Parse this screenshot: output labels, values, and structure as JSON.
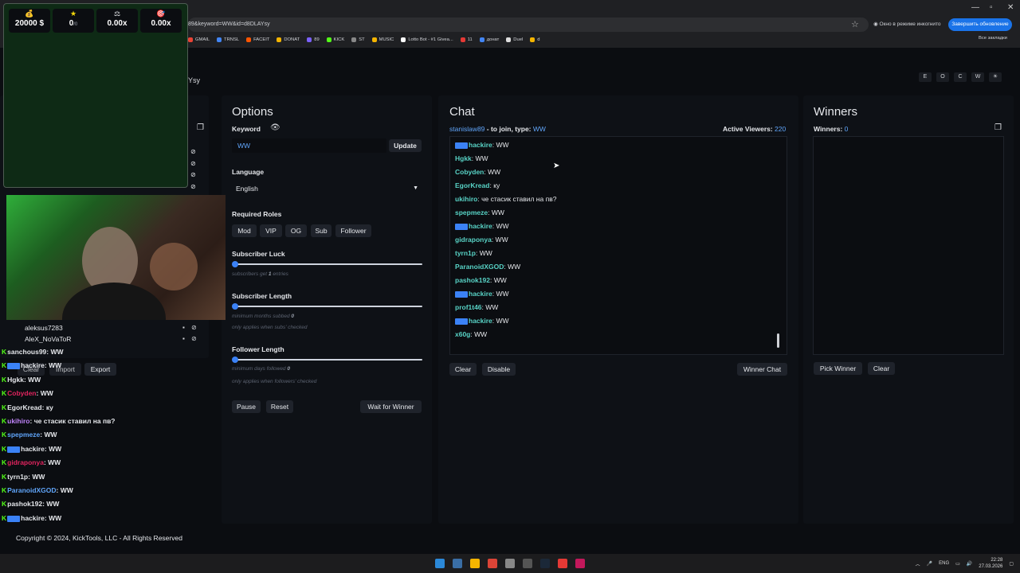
{
  "browser": {
    "url": "89&keyword=WW&id=d8DLAYsy",
    "incognito_label": "Окно в режиме инкогнито",
    "update_button": "Завершить обновление",
    "all_bookmarks": "Все закладки",
    "bookmarks": [
      {
        "label": "GMAIL",
        "color": "#ea4335"
      },
      {
        "label": "TRNSL",
        "color": "#4285f4"
      },
      {
        "label": "FACEIT",
        "color": "#ff5500"
      },
      {
        "label": "DONAT",
        "color": "#f4b400"
      },
      {
        "label": "89",
        "color": "#7b61ff"
      },
      {
        "label": "KICK",
        "color": "#53fc18"
      },
      {
        "label": "ST",
        "color": "#888888"
      },
      {
        "label": "MUSIC",
        "color": "#f4b400"
      },
      {
        "label": "Lotto Bot - #1 Givea...",
        "color": "#ffffff"
      },
      {
        "label": "11",
        "color": "#e53935"
      },
      {
        "label": "донат",
        "color": "#4285f4"
      },
      {
        "label": "Duel",
        "color": "#dddddd"
      },
      {
        "label": "d",
        "color": "#f4b400"
      }
    ]
  },
  "page": {
    "title_fragment": "Ysy",
    "top_buttons": [
      "E",
      "O",
      "C",
      "W",
      "☀"
    ]
  },
  "overlay": {
    "stats": [
      {
        "icon": "money-bag-icon",
        "glyph": "💰",
        "value": "20000 $"
      },
      {
        "icon": "star-icon",
        "glyph": "★",
        "value": "0",
        "suffix": "/0"
      },
      {
        "icon": "scale-icon",
        "glyph": "⚖",
        "value": "0.00x"
      },
      {
        "icon": "target-icon",
        "glyph": "🎯",
        "value": "0.00x"
      }
    ]
  },
  "options": {
    "title": "Options",
    "keyword_label": "Keyword",
    "keyword_value": "WW",
    "update_button": "Update",
    "language_label": "Language",
    "language_value": "English",
    "roles_label": "Required Roles",
    "roles": [
      "Mod",
      "VIP",
      "OG",
      "Sub",
      "Follower"
    ],
    "sub_luck_label": "Subscriber Luck",
    "sub_luck_hint_a": "subscribers get ",
    "sub_luck_value": "1",
    "sub_luck_hint_b": " entries",
    "sub_length_label": "Subscriber Length",
    "sub_length_hint": "minimum months subbed ",
    "sub_length_value": "0",
    "sub_length_note": "only applies when subs' checked",
    "follower_length_label": "Follower Length",
    "follower_length_hint": "minimum days followed ",
    "follower_length_value": "0",
    "follower_length_note": "only applies when followers' checked",
    "pause_button": "Pause",
    "reset_button": "Reset",
    "wait_button": "Wait for Winner"
  },
  "chat": {
    "title": "Chat",
    "join_user": "stanislaw89",
    "join_text": " - to join, type: ",
    "join_keyword": "WW",
    "active_viewers_label": "Active Viewers: ",
    "active_viewers": "220",
    "messages": [
      {
        "user": "sanchous99",
        "text": "WW",
        "badge": false
      },
      {
        "user": "hackire",
        "text": "WW",
        "badge": true
      },
      {
        "user": "Hgkk",
        "text": "WW",
        "badge": false
      },
      {
        "user": "Cobyden",
        "text": "WW",
        "badge": false
      },
      {
        "user": "EgorKread",
        "text": "ку",
        "badge": false
      },
      {
        "user": "ukihiro",
        "text": "че стасик ставил на пв?",
        "badge": false
      },
      {
        "user": "spepmeze",
        "text": "WW",
        "badge": false
      },
      {
        "user": "hackire",
        "text": "WW",
        "badge": true
      },
      {
        "user": "gidraponya",
        "text": "WW",
        "badge": false
      },
      {
        "user": "tyrn1p",
        "text": "WW",
        "badge": false
      },
      {
        "user": "ParanoidXGOD",
        "text": "WW",
        "badge": false
      },
      {
        "user": "pashok192",
        "text": "WW",
        "badge": false
      },
      {
        "user": "hackire",
        "text": "WW",
        "badge": true
      },
      {
        "user": "prof1t46",
        "text": "WW",
        "badge": false
      },
      {
        "user": "hackire",
        "text": "WW",
        "badge": true
      },
      {
        "user": "x60g",
        "text": "WW",
        "badge": false
      }
    ],
    "clear_button": "Clear",
    "disable_button": "Disable",
    "winner_chat_button": "Winner Chat"
  },
  "winners": {
    "title": "Winners",
    "count_label": "Winners: ",
    "count": "0",
    "pick_button": "Pick Winner",
    "clear_button": "Clear"
  },
  "left_panel": {
    "list": [
      {
        "user": "aleksus7283"
      },
      {
        "user": "AleX_NoVaToR"
      }
    ],
    "clear_button": "Clear",
    "import_button": "Import",
    "export_button": "Export"
  },
  "kick_chat": [
    {
      "user": "sanchous99",
      "text": "WW",
      "color": "#e5e7eb",
      "badge": false
    },
    {
      "user": "hackire",
      "text": "WW",
      "color": "#e5e7eb",
      "badge": true
    },
    {
      "user": "Hgkk",
      "text": "WW",
      "color": "#e5e7eb",
      "badge": false
    },
    {
      "user": "Cobyden",
      "text": "WW",
      "color": "#e0245e",
      "badge": false
    },
    {
      "user": "EgorKread",
      "text": "ку",
      "color": "#e5e7eb",
      "badge": false
    },
    {
      "user": "ukihiro",
      "text": "че стасик ставил на пв?",
      "color": "#c084fc",
      "badge": false
    },
    {
      "user": "spepmeze",
      "text": "WW",
      "color": "#60a5fa",
      "badge": false
    },
    {
      "user": "hackire",
      "text": "WW",
      "color": "#e5e7eb",
      "badge": true
    },
    {
      "user": "gidraponya",
      "text": "WW",
      "color": "#e0245e",
      "badge": false
    },
    {
      "user": "tyrn1p",
      "text": "WW",
      "color": "#e5e7eb",
      "badge": false
    },
    {
      "user": "ParanoidXGOD",
      "text": "WW",
      "color": "#60a5fa",
      "badge": false
    },
    {
      "user": "pashok192",
      "text": "WW",
      "color": "#e5e7eb",
      "badge": false
    },
    {
      "user": "hackire",
      "text": "WW",
      "color": "#e5e7eb",
      "badge": true
    }
  ],
  "footer": {
    "text": "Copyright © 2024, KickTools, LLC - All Rights Reserved"
  },
  "taskbar": {
    "lang": "ENG",
    "time": "22:28",
    "date": "27.03.2026"
  }
}
